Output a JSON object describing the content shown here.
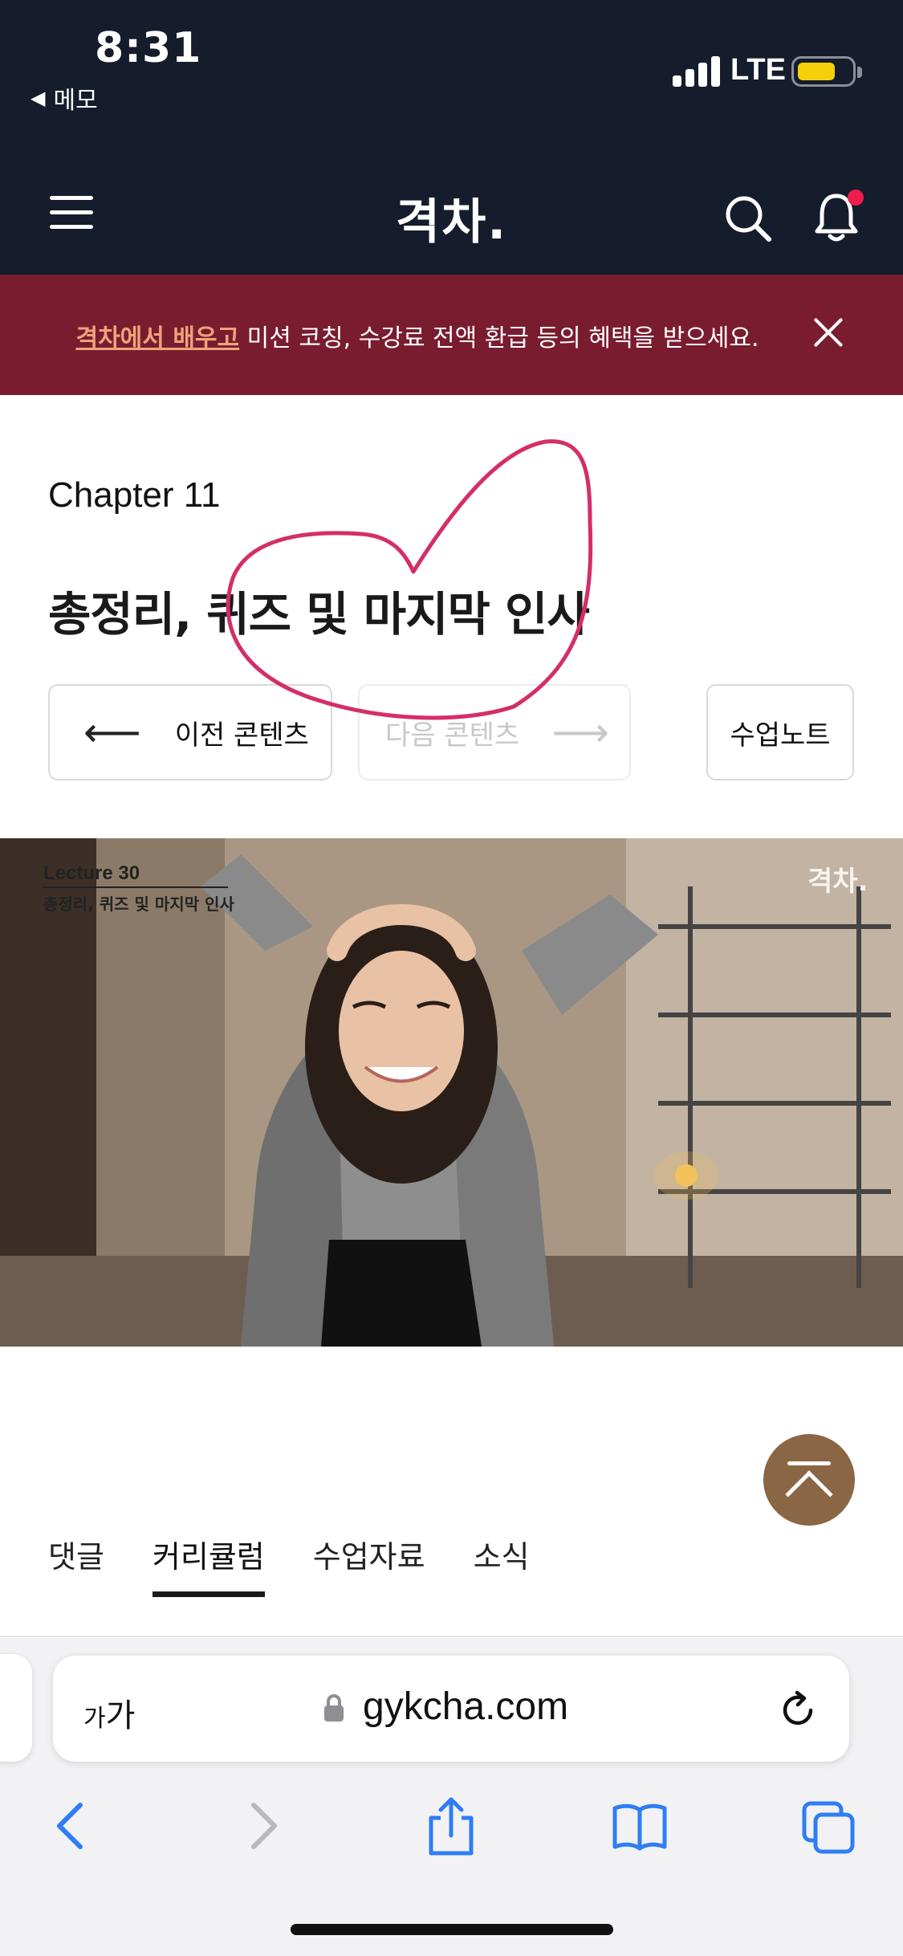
{
  "status_bar": {
    "time": "8:31",
    "back_app": "메모",
    "back_glyph": "◀",
    "network": "LTE",
    "battery_color": "#f4d00c"
  },
  "header": {
    "brand": "격차.",
    "menu_icon": "hamburger-menu-icon",
    "search_icon": "search-icon",
    "bell_icon": "bell-icon",
    "bell_badge_color": "#ec1d4a"
  },
  "banner": {
    "link_text": "격차에서 배우고",
    "text": " 미션 코칭, 수강료 전액 환급 등의 혜택을 받으세요.",
    "close_icon": "close-icon",
    "background": "#7a1c30"
  },
  "lesson": {
    "chapter": "Chapter 11",
    "title": "총정리, 퀴즈 및 마지막 인사",
    "prev_label": "이전 콘텐츠",
    "prev_arrow": "⟵",
    "next_label": "다음 콘텐츠",
    "next_arrow": "⟶",
    "notes_label": "수업노트"
  },
  "video": {
    "lecture": "Lecture 30",
    "subtitle": "총정리, 퀴즈 및 마지막 인사",
    "watermark": "격차."
  },
  "scroll_top": {
    "icon": "scroll-to-top-icon",
    "color": "#8b6644"
  },
  "tabs": [
    {
      "label": "댓글",
      "active": false
    },
    {
      "label": "커리큘럼",
      "active": true
    },
    {
      "label": "수업자료",
      "active": false
    },
    {
      "label": "소식",
      "active": false
    }
  ],
  "browser": {
    "aa_large": "가",
    "aa_small": "가",
    "url": "gykcha.com",
    "accent": "#2f7df6"
  }
}
